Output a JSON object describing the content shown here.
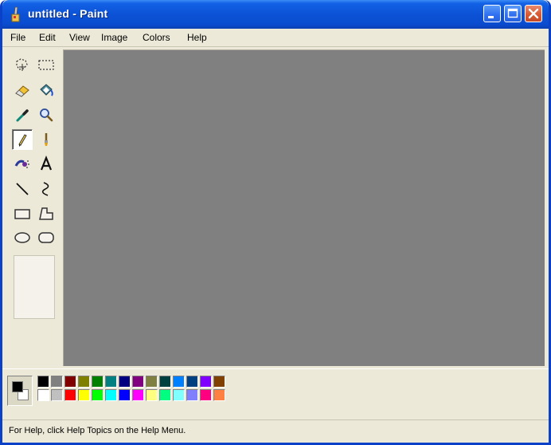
{
  "window": {
    "title": "untitled - Paint",
    "title_color": "#ffffff",
    "titlebar_color": "#0a4ccf"
  },
  "menubar": {
    "items": [
      {
        "label": "File"
      },
      {
        "label": "Edit"
      },
      {
        "label": "View"
      },
      {
        "label": "Image"
      },
      {
        "label": "Colors"
      },
      {
        "label": "Help"
      }
    ]
  },
  "toolbox": {
    "tools": [
      {
        "name": "free-form-select",
        "icon": "free-select-icon"
      },
      {
        "name": "select",
        "icon": "rect-select-icon"
      },
      {
        "name": "eraser",
        "icon": "eraser-icon"
      },
      {
        "name": "fill-with-color",
        "icon": "paint-bucket-icon"
      },
      {
        "name": "pick-color",
        "icon": "eyedropper-icon"
      },
      {
        "name": "magnifier",
        "icon": "magnifier-icon"
      },
      {
        "name": "pencil",
        "icon": "pencil-icon",
        "selected": true
      },
      {
        "name": "brush",
        "icon": "brush-icon"
      },
      {
        "name": "airbrush",
        "icon": "airbrush-icon"
      },
      {
        "name": "text",
        "icon": "text-icon"
      },
      {
        "name": "line",
        "icon": "line-icon"
      },
      {
        "name": "curve",
        "icon": "curve-icon"
      },
      {
        "name": "rectangle",
        "icon": "rectangle-icon"
      },
      {
        "name": "polygon",
        "icon": "polygon-icon"
      },
      {
        "name": "ellipse",
        "icon": "ellipse-icon"
      },
      {
        "name": "rounded-rectangle",
        "icon": "rounded-rect-icon"
      }
    ]
  },
  "canvas": {
    "background": "#808080"
  },
  "palette": {
    "foreground": "#000000",
    "background": "#ffffff",
    "row1": [
      "#000000",
      "#808080",
      "#800000",
      "#808000",
      "#008000",
      "#008080",
      "#000080",
      "#800080",
      "#808040",
      "#004040",
      "#0080ff",
      "#004080",
      "#8000ff",
      "#804000"
    ],
    "row2": [
      "#ffffff",
      "#c0c0c0",
      "#ff0000",
      "#ffff00",
      "#00ff00",
      "#00ffff",
      "#0000ff",
      "#ff00ff",
      "#ffff80",
      "#00ff80",
      "#80ffff",
      "#8080ff",
      "#ff0080",
      "#ff8040"
    ]
  },
  "statusbar": {
    "text": "For Help, click Help Topics on the Help Menu."
  }
}
